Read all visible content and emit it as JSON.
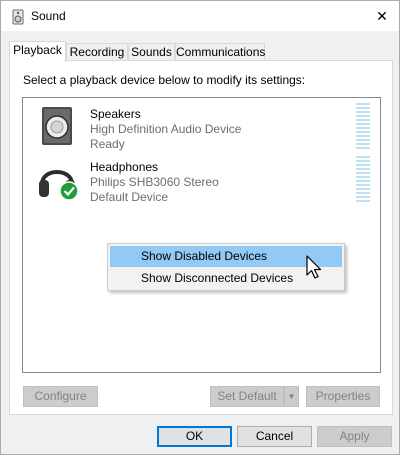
{
  "window": {
    "title": "Sound",
    "icon": "speaker-app-icon",
    "close_glyph": "✕"
  },
  "tabs": [
    {
      "label": "Playback",
      "active": true
    },
    {
      "label": "Recording",
      "active": false
    },
    {
      "label": "Sounds",
      "active": false
    },
    {
      "label": "Communications",
      "active": false
    }
  ],
  "playback": {
    "instruction": "Select a playback device below to modify its settings:",
    "devices": [
      {
        "name": "Speakers",
        "description": "High Definition Audio Device",
        "status": "Ready",
        "icon": "speaker-device-icon",
        "default": false
      },
      {
        "name": "Headphones",
        "description": "Philips SHB3060 Stereo",
        "status": "Default Device",
        "icon": "headphones-device-icon",
        "default": true
      }
    ],
    "level_meter_level": 0
  },
  "context_menu": {
    "items": [
      {
        "label": "Show Disabled Devices",
        "highlighted": true
      },
      {
        "label": "Show Disconnected Devices",
        "highlighted": false
      }
    ]
  },
  "panel_buttons": {
    "configure": "Configure",
    "set_default": "Set Default",
    "set_default_arrow": "▼",
    "properties": "Properties"
  },
  "dialog_buttons": {
    "ok": "OK",
    "cancel": "Cancel",
    "apply": "Apply"
  },
  "colors": {
    "menu_highlight": "#91c9f7",
    "default_check": "#1e9e3a",
    "meter_segment": "#bfe1f4",
    "focus_border": "#0078d7"
  }
}
